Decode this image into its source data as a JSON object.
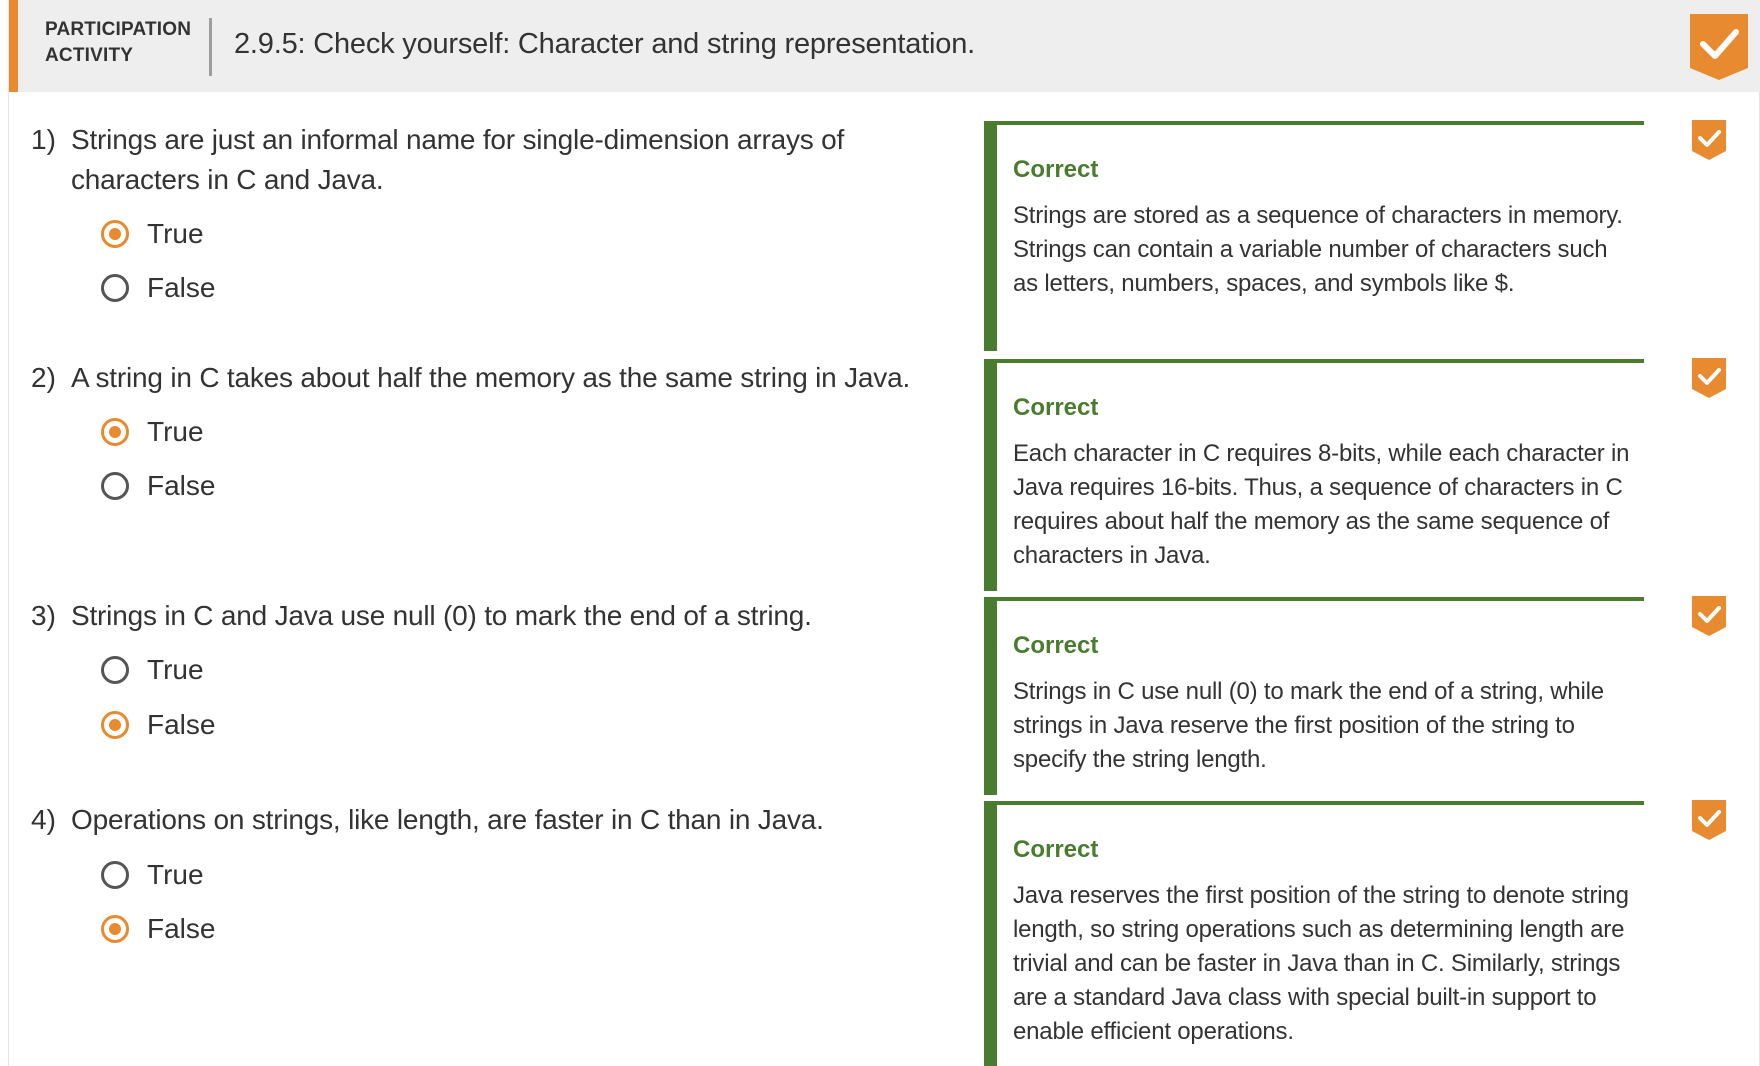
{
  "header": {
    "participation_line1": "PARTICIPATION",
    "participation_line2": "ACTIVITY",
    "title": "2.9.5: Check yourself: Character and string representation.",
    "completion_icon": "checkmark-badge-icon"
  },
  "colors": {
    "accent": "#e88a30",
    "correct": "#4a7c2f",
    "header_bg": "#eeeeee"
  },
  "questions": [
    {
      "number": "1)",
      "text_line1": "Strings are just an informal name for single-dimension arrays of",
      "text_line2": "characters in C and Java.",
      "choices": [
        {
          "label": "True",
          "selected": true
        },
        {
          "label": "False",
          "selected": false
        }
      ],
      "feedback_title": "Correct",
      "feedback_text": "Strings are stored as a sequence of characters in memory. Strings can contain a variable number of characters such as letters, numbers, spaces, and symbols like $."
    },
    {
      "number": "2)",
      "text_line1": "A string in C takes about half the memory as the same string in Java.",
      "text_line2": "",
      "choices": [
        {
          "label": "True",
          "selected": true
        },
        {
          "label": "False",
          "selected": false
        }
      ],
      "feedback_title": "Correct",
      "feedback_text": "Each character in C requires 8-bits, while each character in Java requires 16-bits. Thus, a sequence of characters in C requires about half the memory as the same sequence of characters in Java."
    },
    {
      "number": "3)",
      "text_line1": "Strings in C and Java use null (0) to mark the end of a string.",
      "text_line2": "",
      "choices": [
        {
          "label": "True",
          "selected": false
        },
        {
          "label": "False",
          "selected": true
        }
      ],
      "feedback_title": "Correct",
      "feedback_text": "Strings in C use null (0) to mark the end of a string, while strings in Java reserve the first position of the string to specify the string length."
    },
    {
      "number": "4)",
      "text_line1": "Operations on strings, like length, are faster in C than in Java.",
      "text_line2": "",
      "choices": [
        {
          "label": "True",
          "selected": false
        },
        {
          "label": "False",
          "selected": true
        }
      ],
      "feedback_title": "Correct",
      "feedback_text": "Java reserves the first position of the string to denote string length, so string operations such as determining length are trivial and can be faster in Java than in C. Similarly, strings are a standard Java class with special built-in support to enable efficient operations."
    }
  ]
}
